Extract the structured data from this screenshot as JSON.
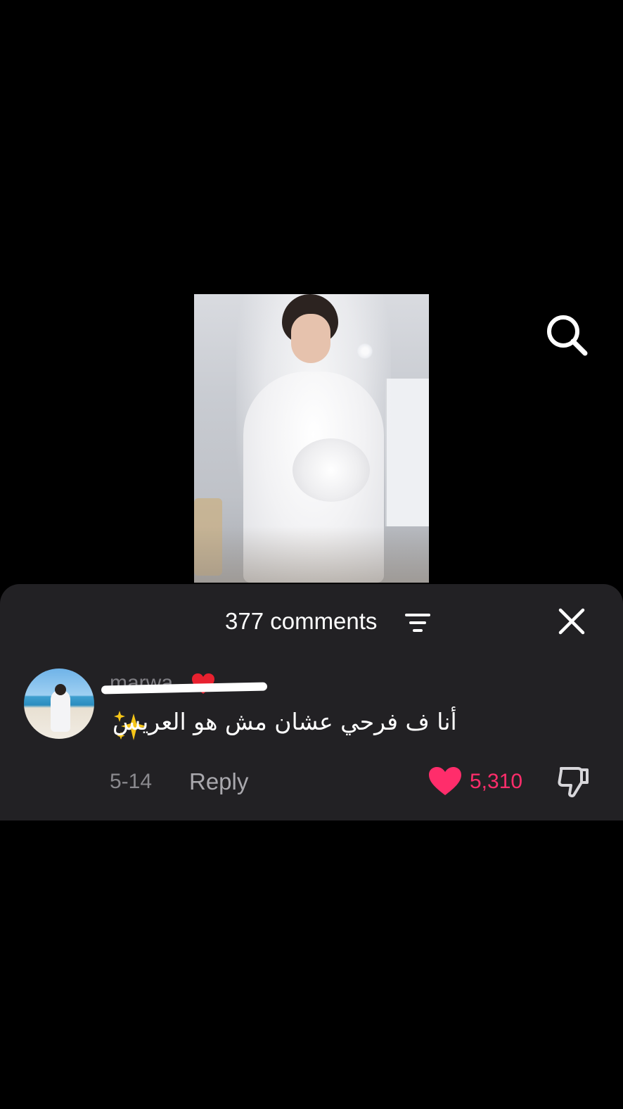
{
  "video": {
    "thumbnail_icon": "bride-photo"
  },
  "search": {
    "icon": "search-icon"
  },
  "comments_panel": {
    "count_label": "377 comments",
    "filter_icon": "filter-icon",
    "close_icon": "close-icon",
    "comments": [
      {
        "username": "marwa",
        "username_emoji": "red-heart",
        "text": "أنا ف فرحي عشان مش هو العريس",
        "text_emoji": "sparkles",
        "date": "5-14",
        "reply_label": "Reply",
        "likes": "5,310",
        "liked": true
      }
    ]
  },
  "colors": {
    "background": "#000000",
    "sheet": "#222124",
    "like_accent": "#ff2d6b",
    "muted_text": "#8a898e"
  }
}
